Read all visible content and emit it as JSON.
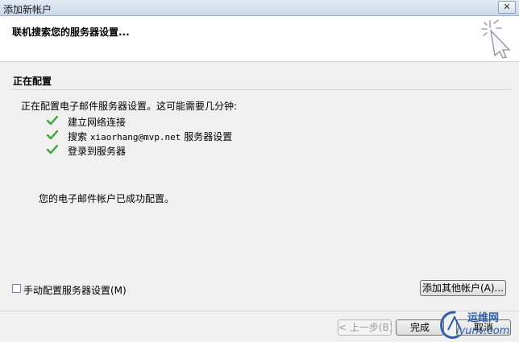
{
  "window": {
    "title": "添加新帐户",
    "close_icon": "close-icon"
  },
  "header": {
    "title": "联机搜索您的服务器设置..."
  },
  "section": {
    "title": "正在配置"
  },
  "status_line": "正在配置电子邮件服务器设置。这可能需要几分钟:",
  "steps": [
    {
      "label": "建立网络连接",
      "icon": "checkmark-icon"
    },
    {
      "label_prefix": "搜索",
      "label_email": "xiaorhang@mvp.net",
      "label_suffix": "服务器设置",
      "icon": "checkmark-icon"
    },
    {
      "label": "登录到服务器",
      "icon": "checkmark-icon"
    }
  ],
  "success_message": "您的电子邮件帐户已成功配置。",
  "manual_config": {
    "label": "手动配置服务器设置(M)",
    "checked": false
  },
  "buttons": {
    "add_other": "添加其他帐户(A)...",
    "back": "< 上一步(B)",
    "finish": "完成",
    "cancel": "取消"
  },
  "watermark": {
    "top": "运维网",
    "bottom": "iyunv.com"
  },
  "colors": {
    "check": "#3aa53a",
    "accent": "#2f5fa8"
  }
}
